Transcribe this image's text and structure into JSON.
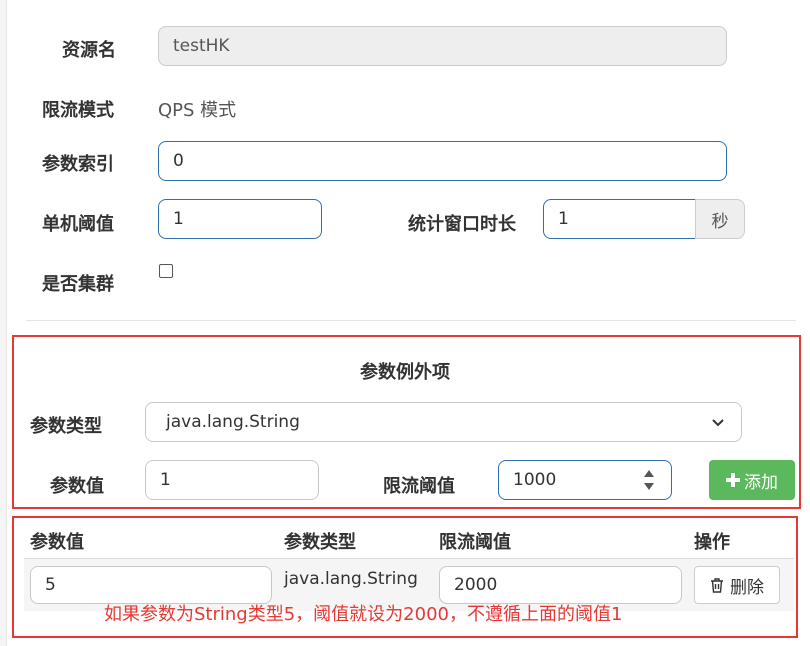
{
  "form": {
    "resource_name_label": "资源名",
    "resource_name_value": "testHK",
    "limit_mode_label": "限流模式",
    "limit_mode_value": "QPS 模式",
    "param_index_label": "参数索引",
    "param_index_value": "0",
    "single_threshold_label": "单机阈值",
    "single_threshold_value": "1",
    "window_label": "统计窗口时长",
    "window_value": "1",
    "window_unit": "秒",
    "cluster_label": "是否集群",
    "cluster_checked": false
  },
  "exceptions": {
    "title": "参数例外项",
    "param_type_label": "参数类型",
    "param_type_value": "java.lang.String",
    "param_value_label": "参数值",
    "param_value_value": "1",
    "threshold_label": "限流阈值",
    "threshold_value": "1000",
    "add_button_label": "添加"
  },
  "table": {
    "headers": [
      "参数值",
      "参数类型",
      "限流阈值",
      "操作"
    ],
    "rows": [
      {
        "param_value": "5",
        "param_type": "java.lang.String",
        "threshold": "2000",
        "action_label": "删除"
      }
    ]
  },
  "annotation": "如果参数为String类型5，阈值就设为2000，不遵循上面的阈值1",
  "colors": {
    "input_border": "#2f6fb0",
    "annotation_red": "#e53935",
    "add_green": "#5cb85c"
  }
}
